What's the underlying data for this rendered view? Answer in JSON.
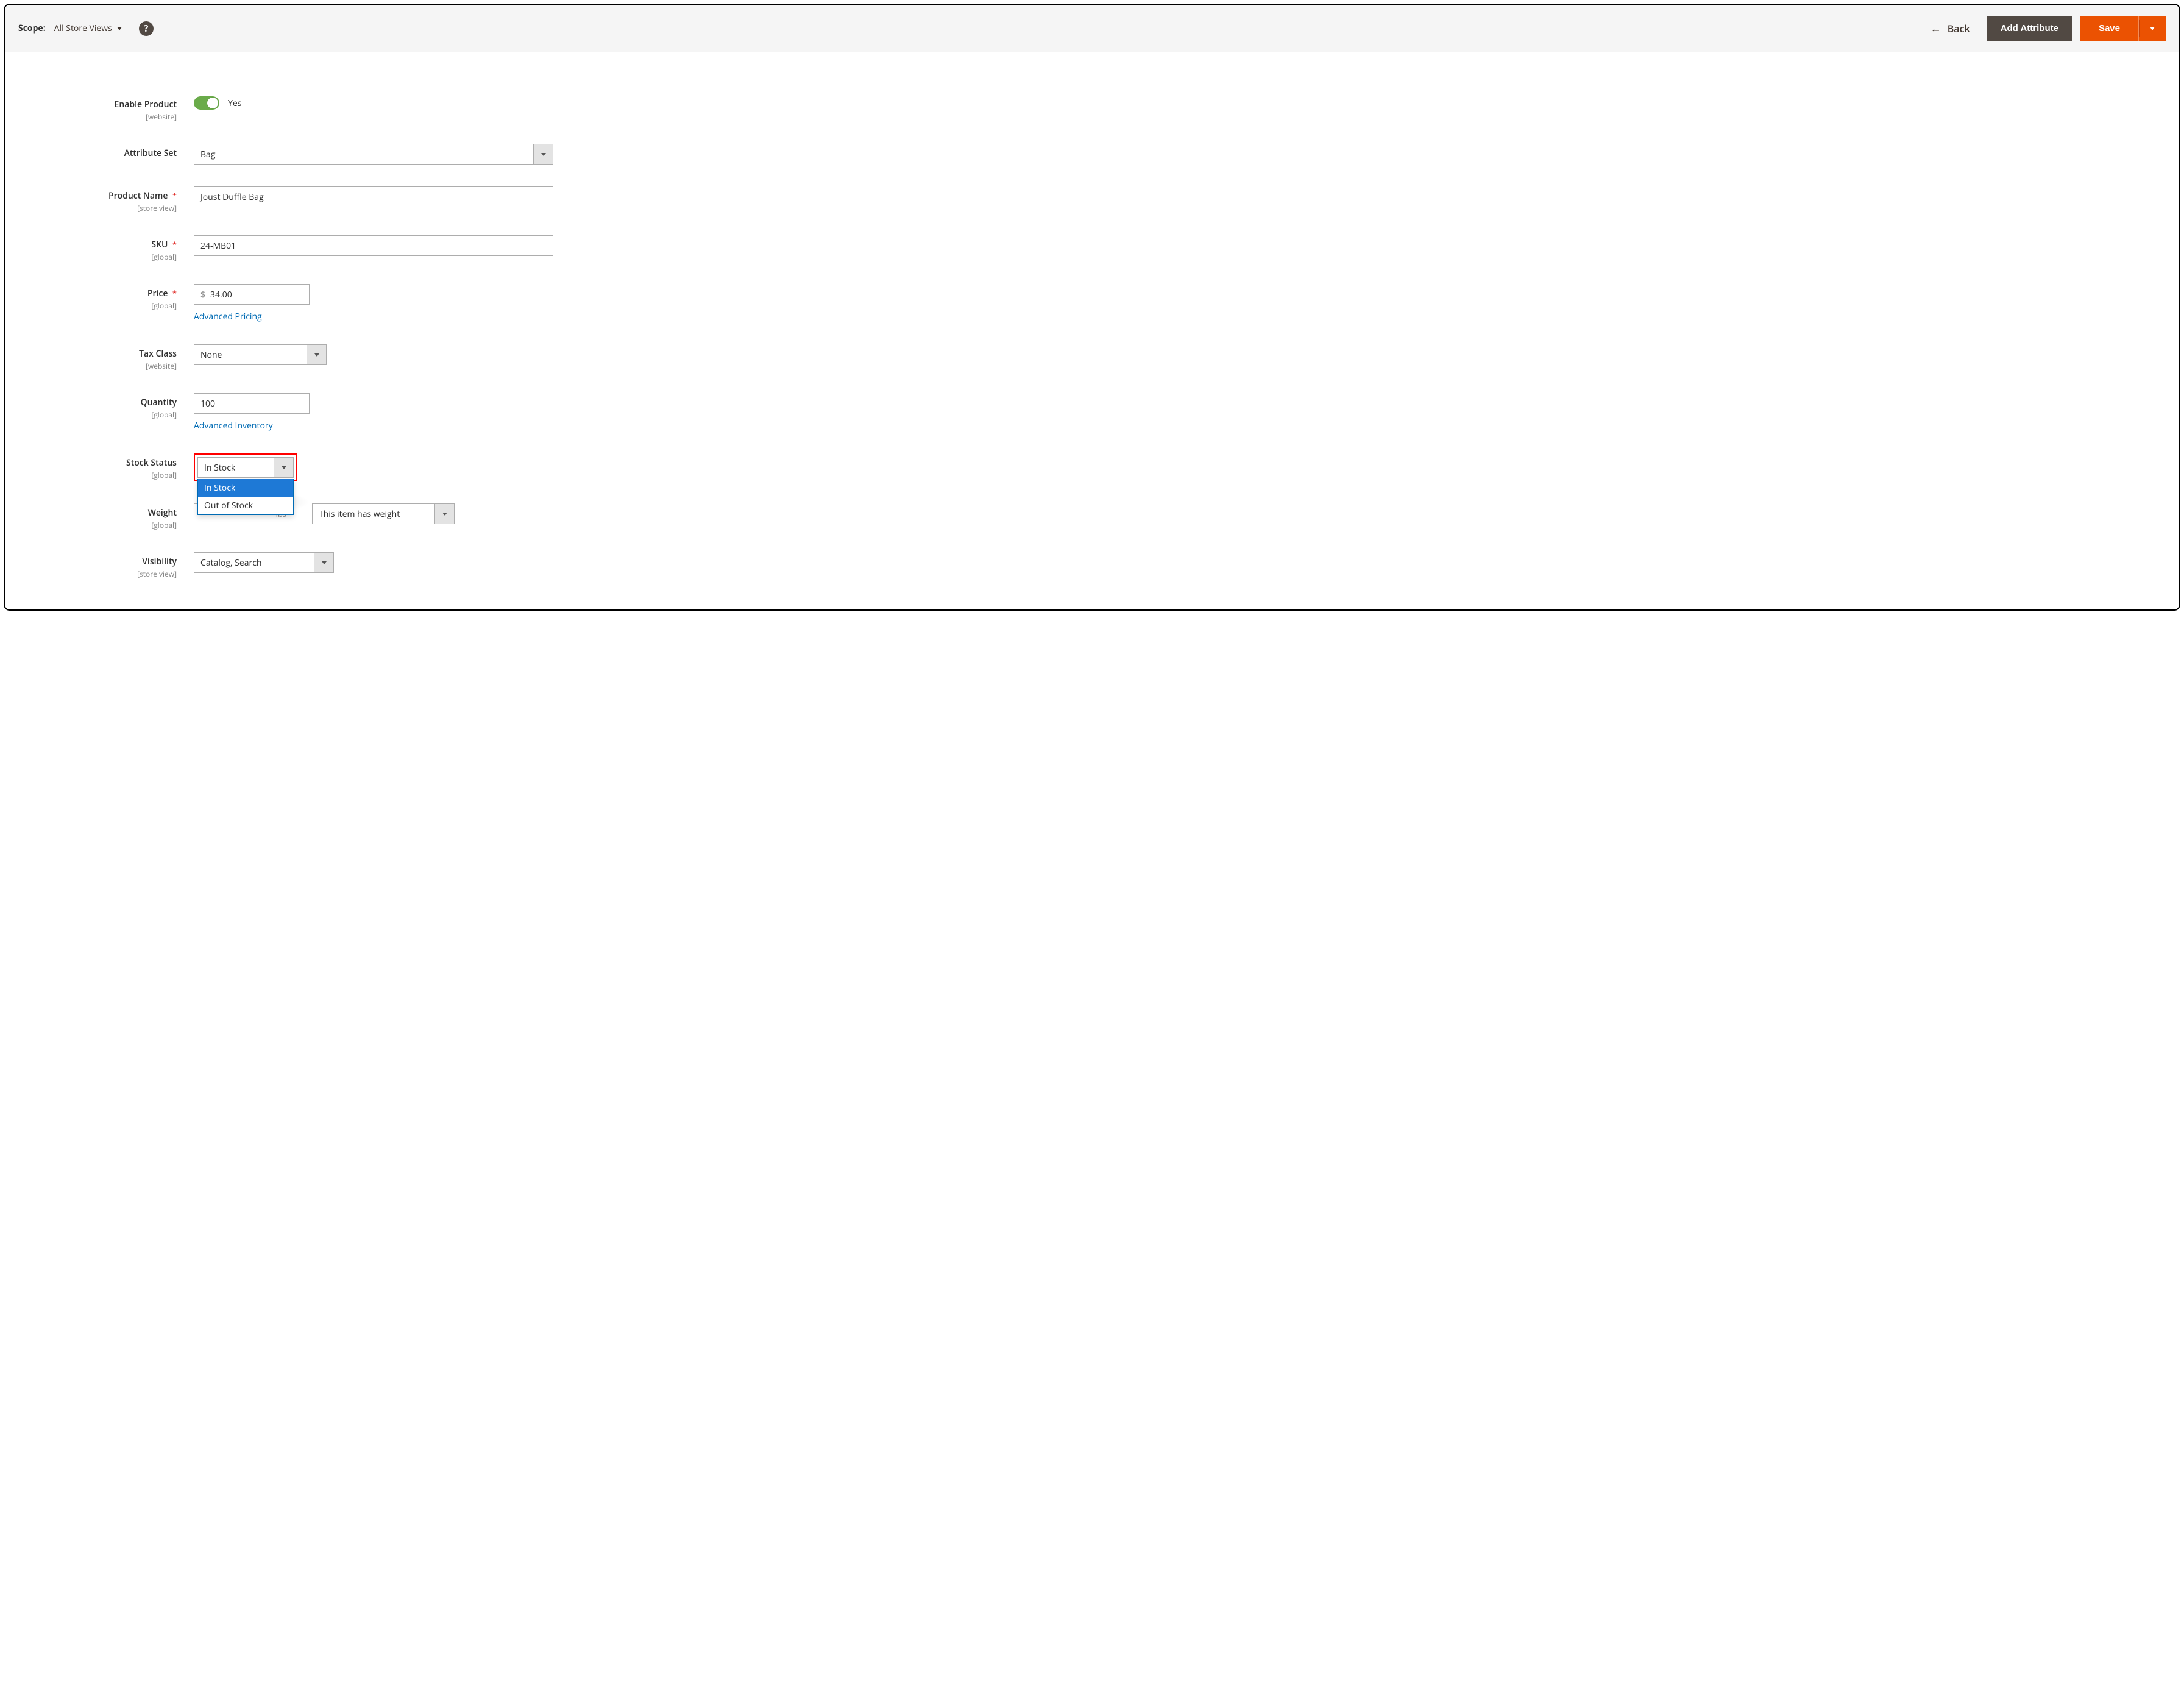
{
  "header": {
    "scope_label": "Scope:",
    "scope_value": "All Store Views",
    "back_label": "Back",
    "add_attribute_label": "Add Attribute",
    "save_label": "Save"
  },
  "fields": {
    "enable_product": {
      "label": "Enable Product",
      "scope": "[website]",
      "value": "Yes"
    },
    "attribute_set": {
      "label": "Attribute Set",
      "value": "Bag"
    },
    "product_name": {
      "label": "Product Name",
      "scope": "[store view]",
      "value": "Joust Duffle Bag"
    },
    "sku": {
      "label": "SKU",
      "scope": "[global]",
      "value": "24-MB01"
    },
    "price": {
      "label": "Price",
      "scope": "[global]",
      "currency": "$",
      "value": "34.00",
      "advanced_link": "Advanced Pricing"
    },
    "tax_class": {
      "label": "Tax Class",
      "scope": "[website]",
      "value": "None"
    },
    "quantity": {
      "label": "Quantity",
      "scope": "[global]",
      "value": "100",
      "advanced_link": "Advanced Inventory"
    },
    "stock_status": {
      "label": "Stock Status",
      "scope": "[global]",
      "value": "In Stock",
      "options": [
        "In Stock",
        "Out of Stock"
      ]
    },
    "weight": {
      "label": "Weight",
      "scope": "[global]",
      "unit": "lbs",
      "type_value": "This item has weight"
    },
    "visibility": {
      "label": "Visibility",
      "scope": "[store view]",
      "value": "Catalog, Search"
    }
  }
}
